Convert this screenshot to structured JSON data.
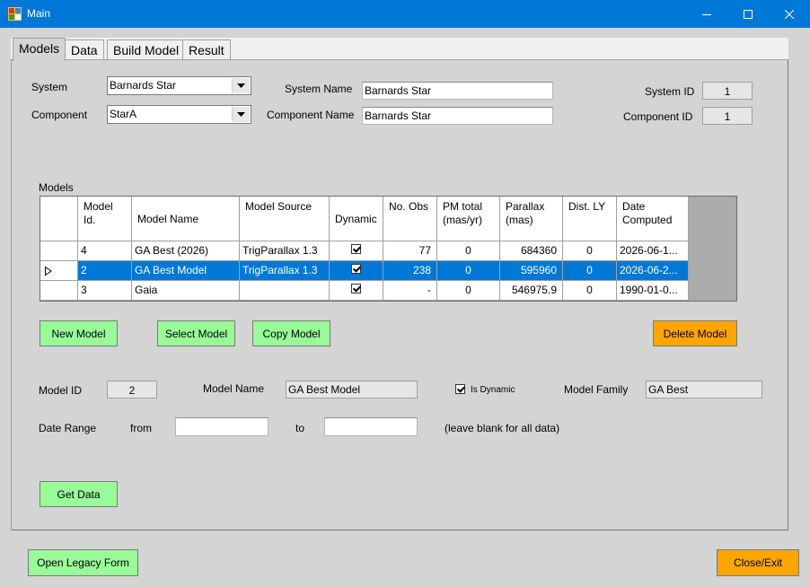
{
  "window": {
    "title": "Main"
  },
  "tabs": [
    "Models",
    "Data",
    "Build Model",
    "Result"
  ],
  "system": {
    "system_label": "System",
    "system_value": "Barnards Star",
    "component_label": "Component",
    "component_value": "StarA",
    "system_name_label": "System Name",
    "system_name_value": "Barnards Star",
    "component_name_label": "Component Name",
    "component_name_value": "Barnards Star",
    "system_id_label": "System ID",
    "system_id_value": "1",
    "component_id_label": "Component ID",
    "component_id_value": "1"
  },
  "models_grid": {
    "label": "Models",
    "columns": [
      "Model Id.",
      "Model Name",
      "Model Source",
      "Dynamic",
      "No. Obs",
      "PM total (mas/yr)",
      "Parallax (mas)",
      "Dist. LY",
      "Date Computed"
    ],
    "rows": [
      {
        "id": "4",
        "name": "GA Best (2026)",
        "source": "TrigParallax 1.3",
        "dynamic": true,
        "obs": "77",
        "pm": "0",
        "parallax": "684360",
        "dist": "0",
        "date": "2026-06-1...",
        "selected": false
      },
      {
        "id": "2",
        "name": "GA Best Model",
        "source": "TrigParallax 1.3",
        "dynamic": true,
        "obs": "238",
        "pm": "0",
        "parallax": "595960",
        "dist": "0",
        "date": "2026-06-2...",
        "selected": true
      },
      {
        "id": "3",
        "name": "Gaia",
        "source": "",
        "dynamic": true,
        "obs": "-",
        "pm": "0",
        "parallax": "546975.9",
        "dist": "0",
        "date": "1990-01-0...",
        "selected": false
      }
    ]
  },
  "buttons": {
    "new_model": "New Model",
    "select_model": "Select Model",
    "copy_model": "Copy Model",
    "delete_model": "Delete Model",
    "get_data": "Get Data",
    "open_legacy": "Open Legacy Form",
    "close_exit": "Close/Exit"
  },
  "model_detail": {
    "model_id_label": "Model ID",
    "model_id_value": "2",
    "model_name_label": "Model Name",
    "model_name_value": "GA Best Model",
    "is_dynamic_label": "Is Dynamic",
    "is_dynamic": true,
    "model_family_label": "Model Family",
    "model_family_value": "GA Best",
    "date_range_label": "Date Range",
    "from_label": "from",
    "to_label": "to",
    "from_value": "",
    "to_value": "",
    "hint": "(leave blank for all data)"
  },
  "colors": {
    "titlebar": "#0078d7",
    "green_button": "#98fb98",
    "orange_button": "#ffa500",
    "selection": "#0078d7"
  }
}
